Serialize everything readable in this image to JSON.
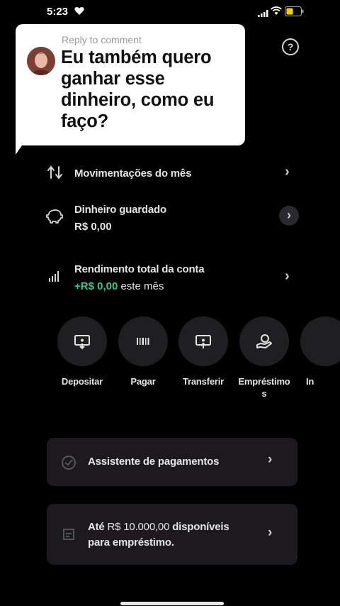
{
  "status": {
    "time": "5:23"
  },
  "comment": {
    "reply_label": "Reply to comment",
    "text": "Eu também quero ganhar esse dinheiro, como eu faço?"
  },
  "help_icon": "?",
  "rows": [
    {
      "title": "Movimentações do mês",
      "icon": "arrows-up-down-icon"
    },
    {
      "title": "Dinheiro guardado",
      "value": "R$ 0,00",
      "icon": "piggy-bank-icon"
    },
    {
      "title": "Rendimento total da conta",
      "value_green": "+R$ 0,00",
      "value_suffix": "este mês",
      "icon": "bar-chart-icon"
    }
  ],
  "chevron": "›",
  "actions": [
    {
      "label": "Depositar",
      "icon": "deposit-icon"
    },
    {
      "label": "Pagar",
      "icon": "barcode-icon"
    },
    {
      "label": "Transferir",
      "icon": "transfer-icon"
    },
    {
      "label_line1": "Empréstimo",
      "label_line2": "s",
      "icon": "loan-icon"
    },
    {
      "label": "In",
      "icon": "more-icon"
    }
  ],
  "cards": [
    {
      "text": "Assistente de pagamentos",
      "icon": "assistant-icon"
    },
    {
      "text_prefix": "Até",
      "text_amount": "R$ 10.000,00",
      "text_line1_end": "disponíveis",
      "text_line2": "para empréstimo.",
      "icon": "loan-offer-icon"
    }
  ],
  "colors": {
    "accent_green": "#2ecc8f",
    "background": "#000000",
    "card_bg": "#1c1a1f"
  }
}
